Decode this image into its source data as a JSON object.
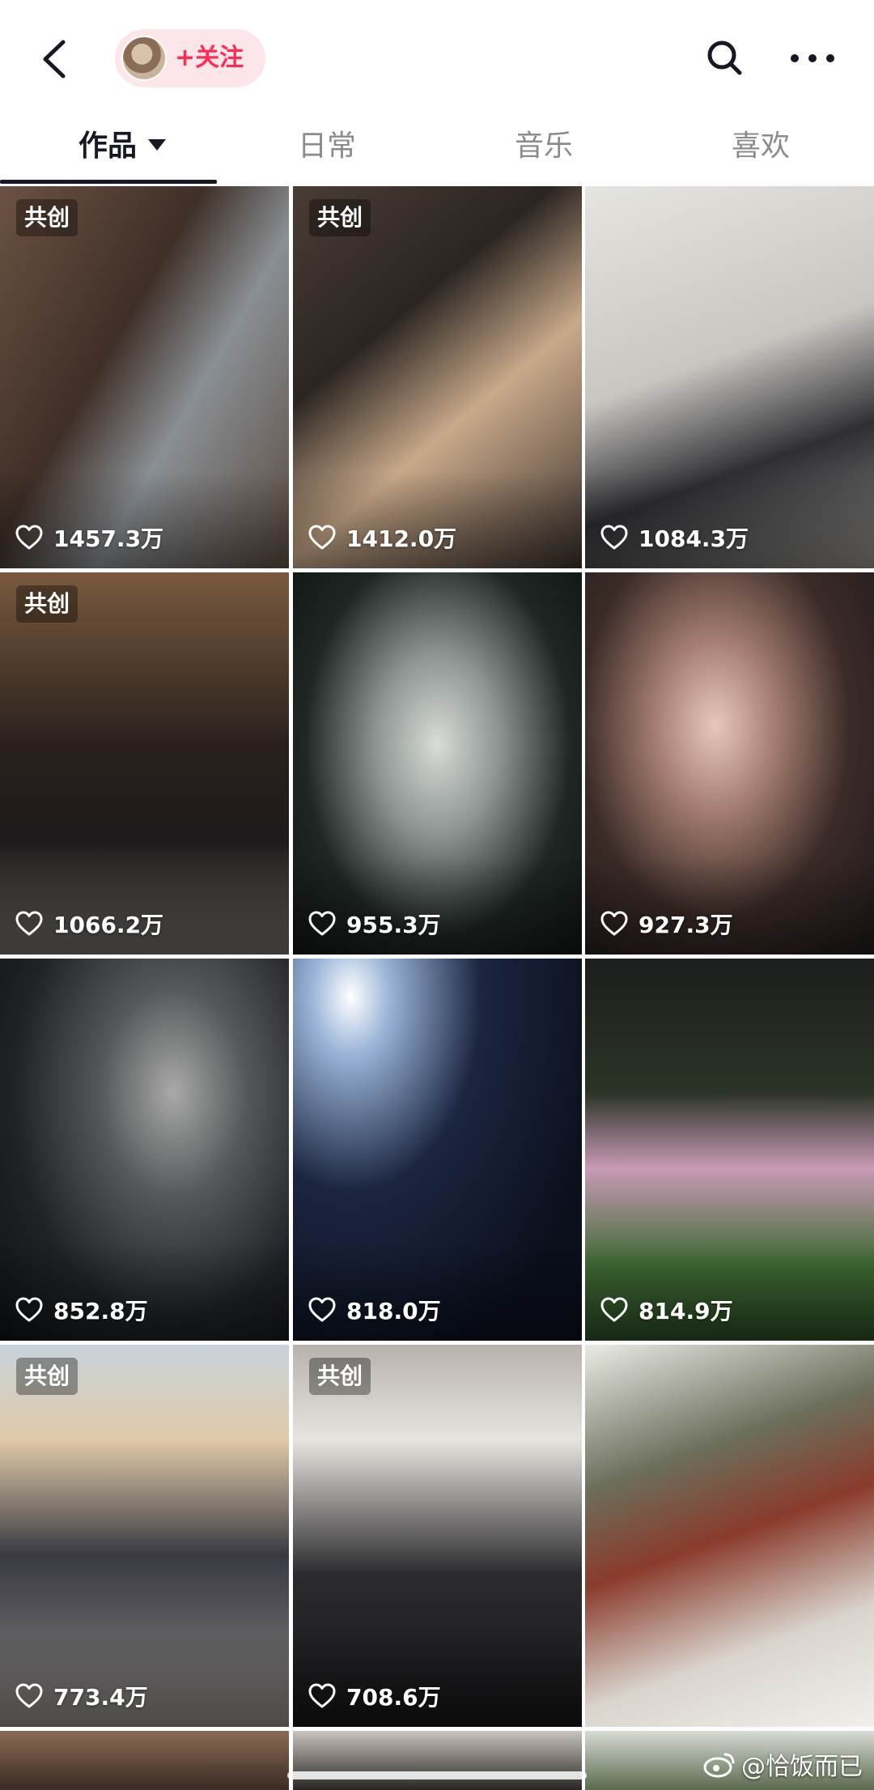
{
  "header": {
    "follow_label": "+关注"
  },
  "tabs": [
    {
      "label": "作品",
      "active": true
    },
    {
      "label": "日常",
      "active": false
    },
    {
      "label": "音乐",
      "active": false
    },
    {
      "label": "喜欢",
      "active": false
    }
  ],
  "videos": [
    {
      "tag": "共创",
      "likes": "1457.3万"
    },
    {
      "tag": "共创",
      "likes": "1412.0万"
    },
    {
      "tag": "",
      "likes": "1084.3万"
    },
    {
      "tag": "共创",
      "likes": "1066.2万"
    },
    {
      "tag": "",
      "likes": "955.3万"
    },
    {
      "tag": "",
      "likes": "927.3万"
    },
    {
      "tag": "",
      "likes": "852.8万"
    },
    {
      "tag": "",
      "likes": "818.0万"
    },
    {
      "tag": "",
      "likes": "814.9万"
    },
    {
      "tag": "共创",
      "likes": "773.4万"
    },
    {
      "tag": "共创",
      "likes": "708.6万"
    },
    {
      "tag": "",
      "likes": ""
    }
  ],
  "watermark": "@恰饭而已",
  "colors": {
    "accent": "#fe2c55",
    "follow_bg": "#fde6ea"
  },
  "icons": [
    "back-arrow-icon",
    "search-icon",
    "more-icon",
    "heart-outline-icon",
    "weibo-icon"
  ]
}
